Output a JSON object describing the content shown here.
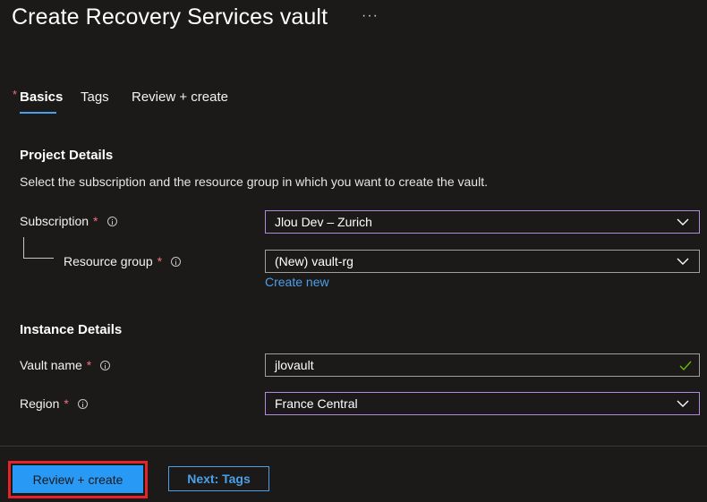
{
  "header": {
    "title": "Create Recovery Services vault",
    "more_label": "···"
  },
  "tabs": [
    {
      "label": "Basics",
      "active": true,
      "required_marker": "*"
    },
    {
      "label": "Tags",
      "active": false
    },
    {
      "label": "Review + create",
      "active": false
    }
  ],
  "project_details": {
    "heading": "Project Details",
    "description": "Select the subscription and the resource group in which you want to create the vault.",
    "subscription": {
      "label": "Subscription",
      "required": "*",
      "value": "Jlou Dev – Zurich"
    },
    "resource_group": {
      "label": "Resource group",
      "required": "*",
      "value": "(New) vault-rg",
      "create_new_label": "Create new"
    }
  },
  "instance_details": {
    "heading": "Instance Details",
    "vault_name": {
      "label": "Vault name",
      "required": "*",
      "value": "jlovault"
    },
    "region": {
      "label": "Region",
      "required": "*",
      "value": "France Central"
    }
  },
  "footer": {
    "review_create_label": "Review + create",
    "next_label": "Next: Tags"
  },
  "colors": {
    "background": "#1b1a19",
    "accent_blue": "#4aa0ea",
    "primary_button": "#2899f5",
    "focus_border": "#b489e0",
    "required_star": "#f1707b",
    "highlight_box": "#e3242b",
    "valid_check": "#6bb700"
  }
}
